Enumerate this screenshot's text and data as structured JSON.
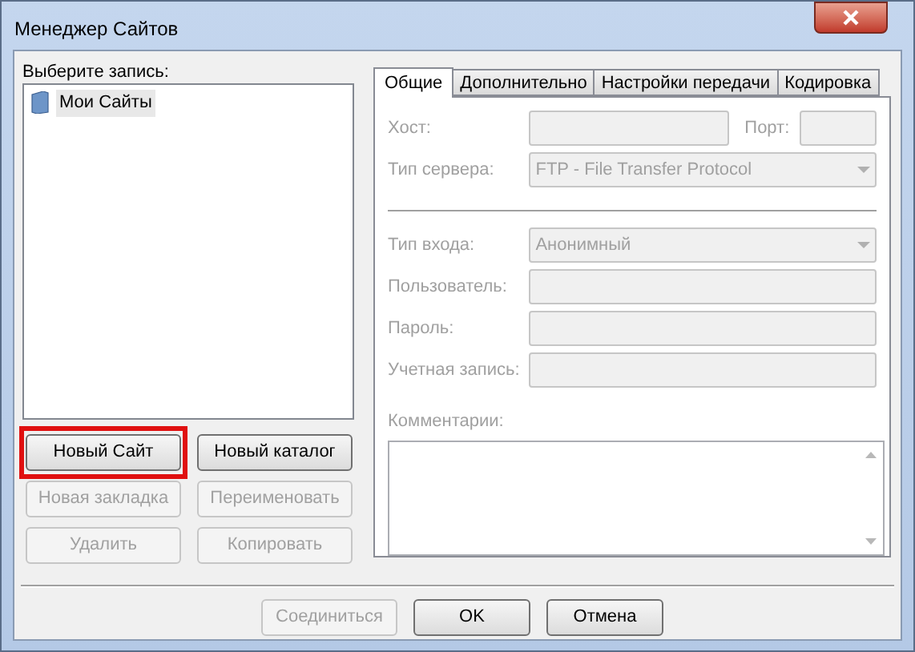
{
  "window": {
    "title": "Менеджер Сайтов"
  },
  "entries": {
    "label": "Выберите запись:",
    "tree": [
      {
        "label": "Мои Сайты",
        "selected": true
      }
    ]
  },
  "entry_buttons": [
    {
      "label": "Новый Сайт",
      "disabled": false,
      "highlighted": true
    },
    {
      "label": "Новый каталог",
      "disabled": false,
      "highlighted": false
    },
    {
      "label": "Новая закладка",
      "disabled": true,
      "highlighted": false
    },
    {
      "label": "Переименовать",
      "disabled": true,
      "highlighted": false
    },
    {
      "label": "Удалить",
      "disabled": true,
      "highlighted": false
    },
    {
      "label": "Копировать",
      "disabled": true,
      "highlighted": false
    }
  ],
  "tabs": [
    {
      "label": "Общие",
      "selected": true
    },
    {
      "label": "Дополнительно",
      "selected": false
    },
    {
      "label": "Настройки передачи",
      "selected": false
    },
    {
      "label": "Кодировка",
      "selected": false
    }
  ],
  "rows": [
    {
      "kind": "fields",
      "fields": [
        {
          "kind": "text",
          "label": "Хост:",
          "disabled": true
        },
        {
          "kind": "short",
          "label": "Порт:",
          "disabled": true
        }
      ]
    },
    {
      "kind": "fields",
      "fields": [
        {
          "kind": "combo",
          "label": "Тип сервера:",
          "value": "FTP - File Transfer Protocol",
          "disabled": true
        }
      ]
    },
    {
      "kind": "separator"
    },
    {
      "kind": "fields",
      "fields": [
        {
          "kind": "combo",
          "label": "Тип входа:",
          "value": "Анонимный",
          "disabled": true
        }
      ]
    },
    {
      "kind": "fields",
      "fields": [
        {
          "kind": "text",
          "label": "Пользователь:",
          "disabled": true
        }
      ]
    },
    {
      "kind": "fields",
      "fields": [
        {
          "kind": "text",
          "label": "Пароль:",
          "disabled": true
        }
      ]
    },
    {
      "kind": "fields",
      "fields": [
        {
          "kind": "text",
          "label": "Учетная запись:",
          "disabled": true
        }
      ]
    }
  ],
  "comments": {
    "label": "Комментарии:",
    "disabled": true
  },
  "dialog_buttons": [
    {
      "label": "Соединиться",
      "disabled": true
    },
    {
      "label": "OK",
      "disabled": false
    },
    {
      "label": "Отмена",
      "disabled": false
    }
  ]
}
